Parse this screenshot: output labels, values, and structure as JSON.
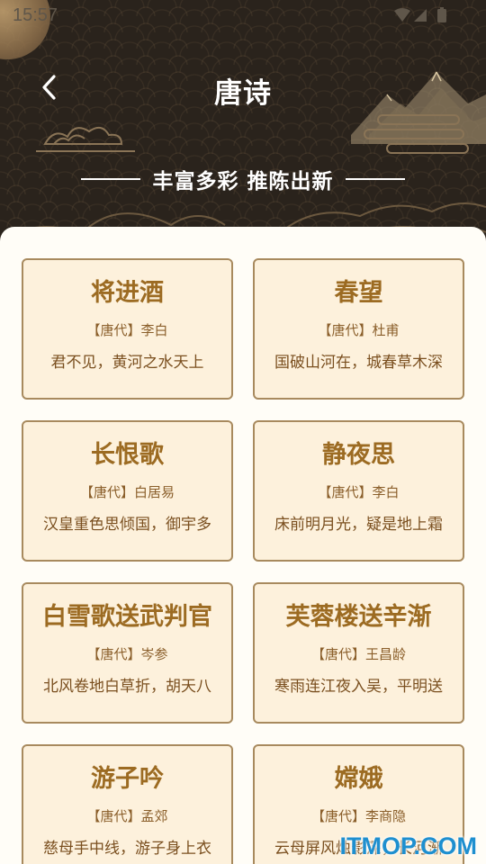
{
  "status_bar": {
    "time": "15:57"
  },
  "header": {
    "title": "唐诗",
    "tagline": "丰富多彩 推陈出新"
  },
  "poems": [
    {
      "title": "将进酒",
      "dynasty_author": "【唐代】李白",
      "first_line": "君不见，黄河之水天上"
    },
    {
      "title": "春望",
      "dynasty_author": "【唐代】杜甫",
      "first_line": "国破山河在，城春草木深"
    },
    {
      "title": "长恨歌",
      "dynasty_author": "【唐代】白居易",
      "first_line": "汉皇重色思倾国，御宇多"
    },
    {
      "title": "静夜思",
      "dynasty_author": "【唐代】李白",
      "first_line": "床前明月光，疑是地上霜"
    },
    {
      "title": "白雪歌送武判官",
      "dynasty_author": "【唐代】岑参",
      "first_line": "北风卷地白草折，胡天八"
    },
    {
      "title": "芙蓉楼送辛渐",
      "dynasty_author": "【唐代】王昌龄",
      "first_line": "寒雨连江夜入吴，平明送"
    },
    {
      "title": "游子吟",
      "dynasty_author": "【唐代】孟郊",
      "first_line": "慈母手中线，游子身上衣"
    },
    {
      "title": "嫦娥",
      "dynasty_author": "【唐代】李商隐",
      "first_line": "云母屏风烛影深，长河渐"
    }
  ],
  "watermark": "ITMOP.COM",
  "colors": {
    "header_bg": "#2a231c",
    "card_bg": "#fdf1dc",
    "card_border": "#a88a5e",
    "title_color": "#9c6b22",
    "watermark": "#1e8fcf"
  },
  "icons": {
    "back": "chevron-left-icon",
    "wifi": "wifi-icon",
    "signal": "signal-icon",
    "battery": "battery-icon"
  }
}
